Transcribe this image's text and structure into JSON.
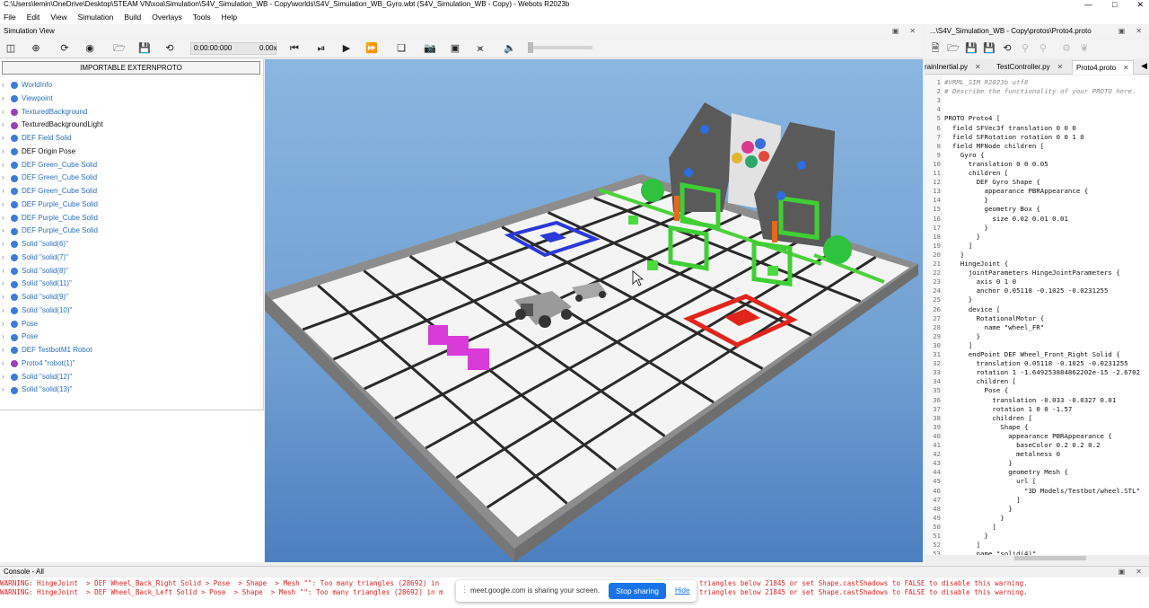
{
  "window": {
    "title": "C:\\Users\\lemin\\OneDrive\\Desktop\\STEAM VN\\xoa\\Simulation\\S4V_Simulation_WB - Copy\\worlds\\S4V_Simulation_WB_Gyro.wbt (S4V_Simulation_WB - Copy) - Webots R2023b"
  },
  "menu": [
    "File",
    "Edit",
    "View",
    "Simulation",
    "Build",
    "Overlays",
    "Tools",
    "Help"
  ],
  "simulation_view": {
    "label": "Simulation View",
    "time": "0:00:00:000",
    "speed": "0.00x"
  },
  "scene_tree": {
    "externproto_button": "IMPORTABLE EXTERNPROTO",
    "items": [
      {
        "label": "WorldInfo",
        "color": "blue",
        "ball": "#3b7dd8"
      },
      {
        "label": "Viewpoint",
        "color": "blue",
        "ball": "#3b7dd8"
      },
      {
        "label": "TexturedBackground",
        "color": "blue",
        "ball": "#9a3fb8"
      },
      {
        "label": "TexturedBackgroundLight",
        "color": "dark",
        "ball": "#9a3fb8"
      },
      {
        "label": "DEF Field Solid",
        "color": "blue",
        "ball": "#3b7dd8"
      },
      {
        "label": "DEF Origin Pose",
        "color": "dark",
        "ball": "#3b7dd8"
      },
      {
        "label": "DEF Green_Cube Solid",
        "color": "blue",
        "ball": "#3b7dd8"
      },
      {
        "label": "DEF Green_Cube Solid",
        "color": "blue",
        "ball": "#3b7dd8"
      },
      {
        "label": "DEF Green_Cube Solid",
        "color": "blue",
        "ball": "#3b7dd8"
      },
      {
        "label": "DEF Purple_Cube Solid",
        "color": "blue",
        "ball": "#3b7dd8"
      },
      {
        "label": "DEF Purple_Cube Solid",
        "color": "blue",
        "ball": "#3b7dd8"
      },
      {
        "label": "DEF Purple_Cube Solid",
        "color": "blue",
        "ball": "#3b7dd8"
      },
      {
        "label": "Solid \"solid(6)\"",
        "color": "blue",
        "ball": "#3b7dd8"
      },
      {
        "label": "Solid \"solid(7)\"",
        "color": "blue",
        "ball": "#3b7dd8"
      },
      {
        "label": "Solid \"solid(8)\"",
        "color": "blue",
        "ball": "#3b7dd8"
      },
      {
        "label": "Solid \"solid(11)\"",
        "color": "blue",
        "ball": "#3b7dd8"
      },
      {
        "label": "Solid \"solid(9)\"",
        "color": "blue",
        "ball": "#3b7dd8"
      },
      {
        "label": "Solid \"solid(10)\"",
        "color": "blue",
        "ball": "#3b7dd8"
      },
      {
        "label": "Pose",
        "color": "blue",
        "ball": "#3b7dd8"
      },
      {
        "label": "Pose",
        "color": "blue",
        "ball": "#3b7dd8"
      },
      {
        "label": "DEF TestbotM1 Robot",
        "color": "blue",
        "ball": "#3b7dd8"
      },
      {
        "label": "Proto4 \"robot(1)\"",
        "color": "blue",
        "ball": "#9a3fb8"
      },
      {
        "label": "Solid \"solid(12)\"",
        "color": "blue",
        "ball": "#3b7dd8"
      },
      {
        "label": "Solid \"solid(13)\"",
        "color": "blue",
        "ball": "#3b7dd8"
      }
    ]
  },
  "editor": {
    "header": "...\\S4V_Simulation_WB - Copy\\protos\\Proto4.proto",
    "tabs": [
      {
        "label": "rainInertial.py",
        "active": false
      },
      {
        "label": "TestController.py",
        "active": false
      },
      {
        "label": "Proto4.proto",
        "active": true
      }
    ],
    "lines": [
      "#VRML_SIM R2023b utf8",
      "# Describe the functionality of your PROTO here.",
      "",
      "",
      "PROTO Proto4 [",
      "  field SFVec3f translation 0 0 0",
      "  field SFRotation rotation 0 0 1 0",
      "  field MFNode children [",
      "    Gyro {",
      "      translation 0 0 0.05",
      "      children [",
      "        DEF Gyro Shape {",
      "          appearance PBRAppearance {",
      "          }",
      "          geometry Box {",
      "            size 0.02 0.01 0.01",
      "          }",
      "        }",
      "      ]",
      "    }",
      "    HingeJoint {",
      "      jointParameters HingeJointParameters {",
      "        axis 0 1 0",
      "        anchor 0.05118 -0.1025 -0.0231255",
      "      }",
      "      device [",
      "        RotationalMotor {",
      "          name \"wheel_FR\"",
      "        }",
      "      ]",
      "      endPoint DEF Wheel_Front_Right Solid {",
      "        translation 0.05118 -0.1025 -0.0231255",
      "        rotation 1 -1.649253884862202e-15 -2.6702",
      "        children [",
      "          Pose {",
      "            translation -0.033 -0.0327 0.01",
      "            rotation 1 0 0 -1.57",
      "            children [",
      "              Shape {",
      "                appearance PBRAppearance {",
      "                  baseColor 0.2 0.2 0.2",
      "                  metalness 0",
      "                }",
      "                geometry Mesh {",
      "                  url [",
      "                    \"3D Models/Testbot/wheel.STL\"",
      "                  ]",
      "                }",
      "              }",
      "            ]",
      "          }",
      "        ]",
      "        name \"solid(4)\""
    ]
  },
  "console": {
    "label": "Console - All",
    "warnings": [
      "WARNING: HingeJoint  > DEF Wheel_Back_Right Solid > Pose  > Shape  > Mesh \"\": Too many triangles (28692) in",
      "WARNING: HingeJoint  > DEF Wheel_Back_Left Solid > Pose  > Shape  > Mesh \"\": Too many triangles (28692) in m"
    ],
    "warnings_tail": [
      "triangles below 21845 or set Shape.castShadows to FALSE to disable this warning.",
      "triangles below 21845 or set Shape.castShadows to FALSE to disable this warning."
    ]
  },
  "screen_share": {
    "message": "meet.google.com is sharing your screen.",
    "stop_label": "Stop sharing",
    "hide_label": "Hide"
  },
  "colors": {
    "accent": "#1a73e8",
    "warning": "#dd2222",
    "scene_blue": "#2b6fb8",
    "sky_top": "#7fb0dd",
    "sky_bottom": "#4a80c0"
  }
}
